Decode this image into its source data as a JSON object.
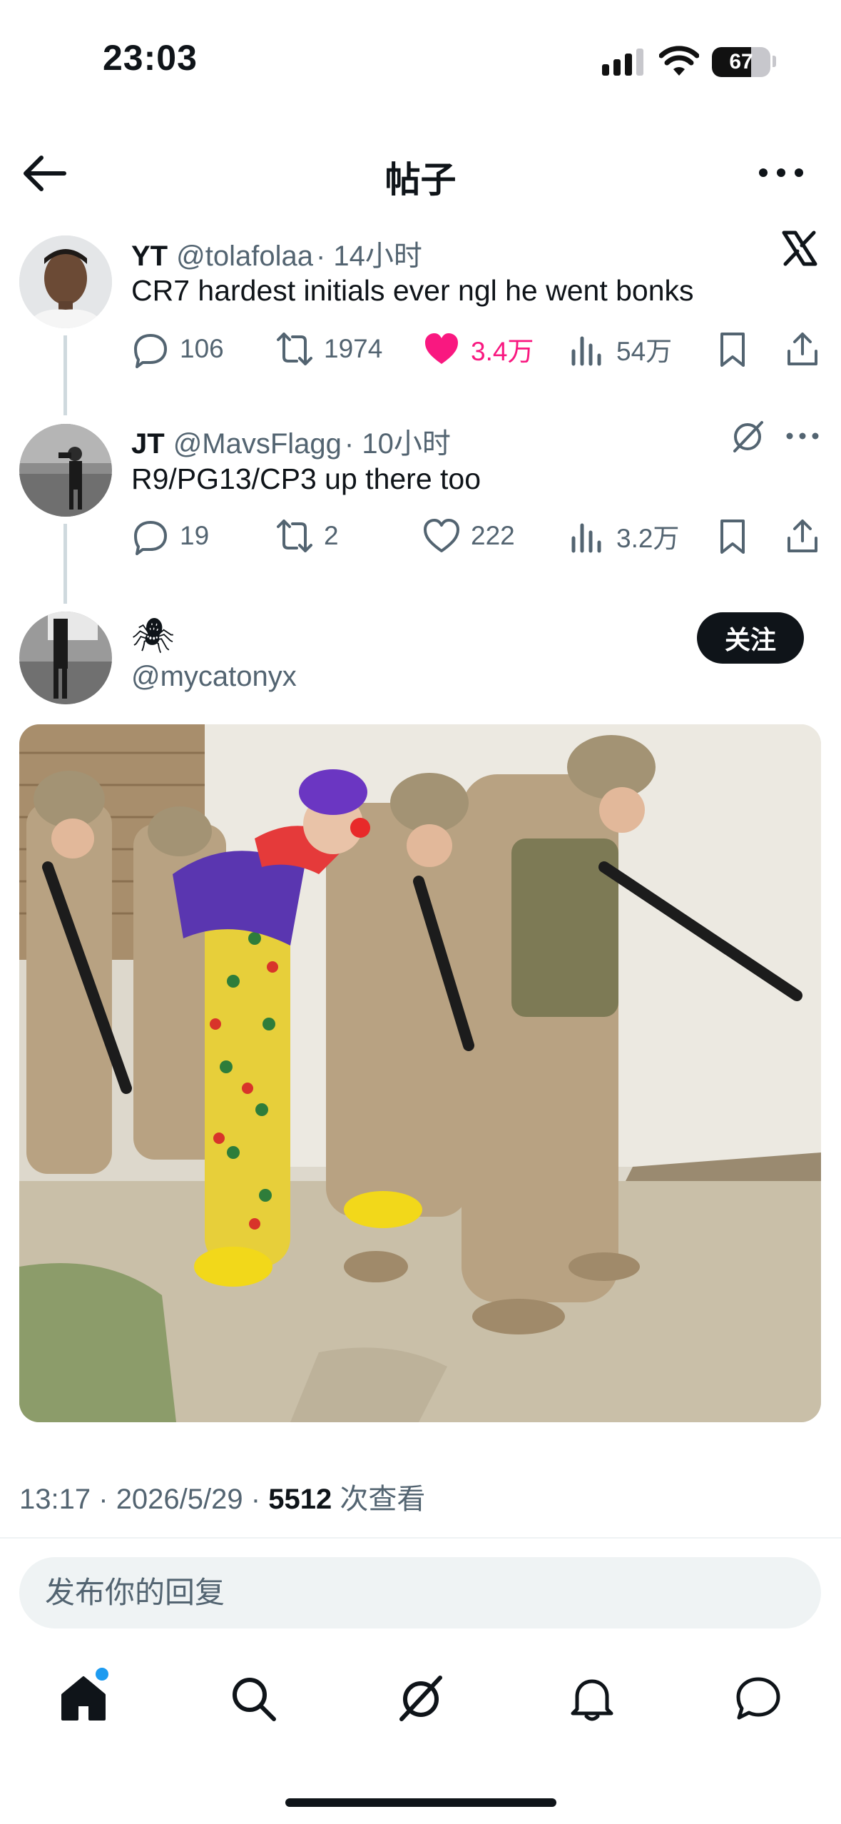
{
  "status_bar": {
    "time": "23:03",
    "battery": "67",
    "battery_level": 0.67
  },
  "header": {
    "title": "帖子"
  },
  "tweets": [
    {
      "name": "YT",
      "handle": "@tolafolaa",
      "time": "· 14小时",
      "text": "CR7 hardest initials ever ngl he went bonks",
      "replies": "106",
      "retweets": "1974",
      "likes": "3.4万",
      "views": "54万",
      "liked": true
    },
    {
      "name": "JT",
      "handle": "@MavsFlagg",
      "time": "· 10小时",
      "text": "R9/PG13/CP3 up there too",
      "replies": "19",
      "retweets": "2",
      "likes": "222",
      "views": "3.2万",
      "liked": false
    }
  ],
  "main_post": {
    "display_name": "🕷",
    "handle": "@mycatonyx",
    "follow_label": "关注",
    "time": "13:17",
    "date": "2026/5/29",
    "views": "5512",
    "views_label": "次查看",
    "sep": "·"
  },
  "reply": {
    "placeholder": "发布你的回复"
  },
  "nav": {
    "items": [
      "home-icon",
      "search-icon",
      "grok-icon",
      "notifications-icon",
      "messages-icon"
    ]
  },
  "colors": {
    "like": "#f91880",
    "text": "#0f1419",
    "secondary": "#536471",
    "notification_dot": "#1d9bf0"
  }
}
